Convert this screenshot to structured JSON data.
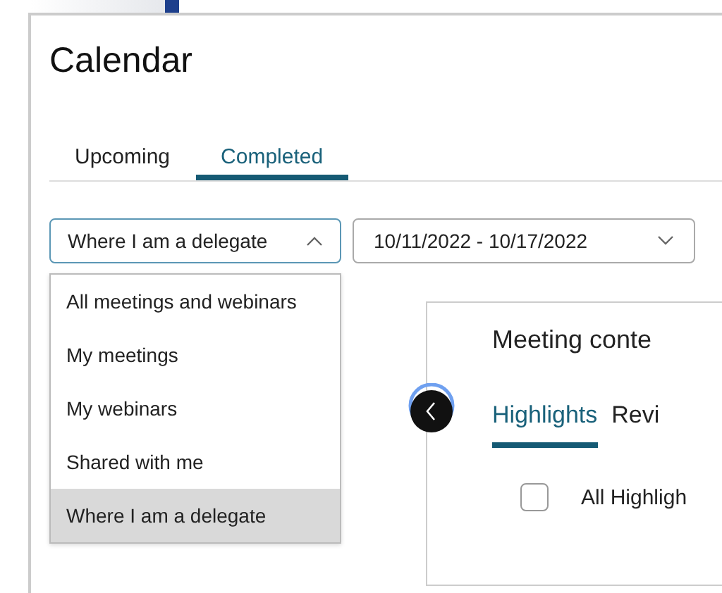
{
  "page": {
    "title": "Calendar"
  },
  "tabs": [
    {
      "label": "Upcoming",
      "selected": false
    },
    {
      "label": "Completed",
      "selected": true
    }
  ],
  "filter_dropdown": {
    "value": "Where I am a delegate",
    "expanded": true
  },
  "date_dropdown": {
    "value": "10/11/2022 - 10/17/2022",
    "expanded": false
  },
  "filter_menu": [
    {
      "label": "All meetings and webinars",
      "selected": false
    },
    {
      "label": "My meetings",
      "selected": false
    },
    {
      "label": "My webinars",
      "selected": false
    },
    {
      "label": "Shared with me",
      "selected": false
    },
    {
      "label": "Where I am a delegate",
      "selected": true
    }
  ],
  "panel": {
    "title": "Meeting conte",
    "tabs": [
      {
        "label": "Highlights",
        "selected": true
      },
      {
        "label": "Revi",
        "selected": false
      }
    ],
    "checkbox": {
      "label": "All Highligh",
      "checked": false
    }
  }
}
